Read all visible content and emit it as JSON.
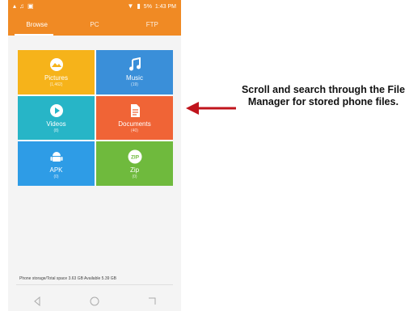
{
  "statusbar": {
    "left_icons": [
      "notification-icon",
      "music-note-icon",
      "image-icon"
    ],
    "battery": "5%",
    "time": "1:43 PM"
  },
  "tabs": [
    {
      "label": "Browse",
      "active": true
    },
    {
      "label": "PC",
      "active": false
    },
    {
      "label": "FTP",
      "active": false
    }
  ],
  "categories": [
    {
      "key": "pictures",
      "label": "Pictures",
      "count": "(1,462)",
      "color": "#f6b31a",
      "icon": "photo-icon"
    },
    {
      "key": "music",
      "label": "Music",
      "count": "(19)",
      "color": "#3a8fd9",
      "icon": "music-icon"
    },
    {
      "key": "videos",
      "label": "Videos",
      "count": "(8)",
      "color": "#27b5c7",
      "icon": "play-icon"
    },
    {
      "key": "documents",
      "label": "Documents",
      "count": "(40)",
      "color": "#f06436",
      "icon": "document-icon"
    },
    {
      "key": "apk",
      "label": "APK",
      "count": "(0)",
      "color": "#2e9ce6",
      "icon": "android-icon"
    },
    {
      "key": "zip",
      "label": "Zip",
      "count": "(0)",
      "color": "#6fba3d",
      "icon": "zip-icon"
    }
  ],
  "storage": {
    "text": "Phone storage/Total space 3.63 GB Available 5.39 GB"
  },
  "callout": {
    "text": "Scroll and search through the File Manager for stored phone files."
  },
  "colors": {
    "accent": "#f08a24",
    "arrow": "#c0141c"
  }
}
